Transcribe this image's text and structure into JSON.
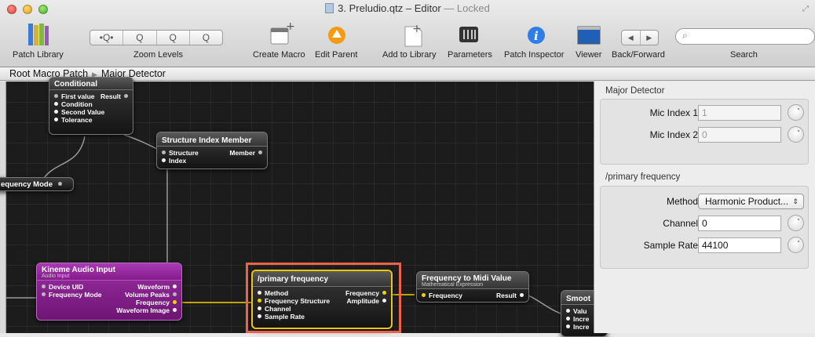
{
  "window": {
    "title": "3. Preludio.qtz – Editor",
    "status": "— Locked"
  },
  "toolbar": {
    "patch_library": "Patch Library",
    "zoom_levels": "Zoom Levels",
    "zoom_buttons": [
      "•Q•",
      "Q",
      "Q",
      "Q"
    ],
    "create_macro": "Create Macro",
    "edit_parent": "Edit Parent",
    "add_to_library": "Add to Library",
    "parameters": "Parameters",
    "patch_inspector": "Patch Inspector",
    "viewer": "Viewer",
    "back_forward": "Back/Forward",
    "back_glyph": "◀",
    "forward_glyph": "▶",
    "search_label": "Search",
    "search_value": ""
  },
  "breadcrumb": {
    "root": "Root Macro Patch",
    "current": "Major Detector"
  },
  "nodes": {
    "conditional": {
      "title": "Conditional",
      "in": [
        "First value",
        "Condition",
        "Second Value",
        "Tolerance"
      ],
      "out": [
        "Result"
      ]
    },
    "structure_index": {
      "title": "Structure Index Member",
      "in": [
        "Structure",
        "Index"
      ],
      "out": [
        "Member"
      ]
    },
    "frequency_mode": {
      "title": "equency Mode"
    },
    "kineme": {
      "title": "Kineme Audio Input",
      "subtitle": "Audio Input",
      "in": [
        "Device UID",
        "Frequency Mode"
      ],
      "out": [
        "Waveform",
        "Volume Peaks",
        "Frequency",
        "Waveform Image"
      ]
    },
    "primary": {
      "title": "/primary frequency",
      "in": [
        "Method",
        "Frequency Structure",
        "Channel",
        "Sample Rate"
      ],
      "out": [
        "Frequency",
        "Amplitude"
      ]
    },
    "freq_midi": {
      "title": "Frequency to Midi Value",
      "subtitle": "Mathematical Expression",
      "in": [
        "Frequency"
      ],
      "out": [
        "Result"
      ]
    },
    "smooth": {
      "title": "Smoot",
      "in": [
        "Valu",
        "Incre",
        "Incre"
      ]
    }
  },
  "inspector": {
    "group1": {
      "title": "Major Detector",
      "mic1_label": "Mic Index 1",
      "mic1_value": "1",
      "mic2_label": "Mic Index 2",
      "mic2_value": "0"
    },
    "group2": {
      "title": "/primary frequency",
      "method_label": "Method",
      "method_value": "Harmonic Product...",
      "channel_label": "Channel",
      "channel_value": "0",
      "sample_label": "Sample Rate",
      "sample_value": "44100"
    }
  },
  "colors": {
    "selection_frame": "#e8634a",
    "selected_node_border": "#f1c40f",
    "wire_yellow": "#f5d000",
    "kineme_node": "#861b8d"
  }
}
